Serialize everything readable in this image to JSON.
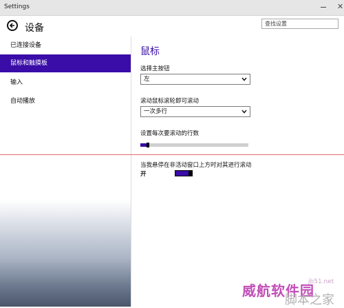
{
  "window": {
    "title": "Settings"
  },
  "header": {
    "title": "设备",
    "search_placeholder": "查找设置"
  },
  "sidebar": {
    "items": [
      {
        "label": "已连接设备",
        "selected": false
      },
      {
        "label": "鼠标和触摸板",
        "selected": true
      },
      {
        "label": "输入",
        "selected": false
      },
      {
        "label": "自动播放",
        "selected": false
      }
    ]
  },
  "main": {
    "heading": "鼠标",
    "primary_button": {
      "label": "选择主按钮",
      "value": "左"
    },
    "scroll_mode": {
      "label": "滚动鼠标滚轮即可滚动",
      "value": "一次多行"
    },
    "lines_to_scroll": {
      "label": "设置每次要滚动的行数",
      "value_percent": 7
    },
    "scroll_inactive": {
      "label": "当我悬停在非活动窗口上方时对其进行滚动",
      "state_label": "开",
      "on": true
    }
  },
  "colors": {
    "accent": "#3a0ca8",
    "divider_line": "#e26a6a"
  },
  "watermark": {
    "url": "jb51.net",
    "main": "威航软件园",
    "sub": "脚本之家"
  }
}
